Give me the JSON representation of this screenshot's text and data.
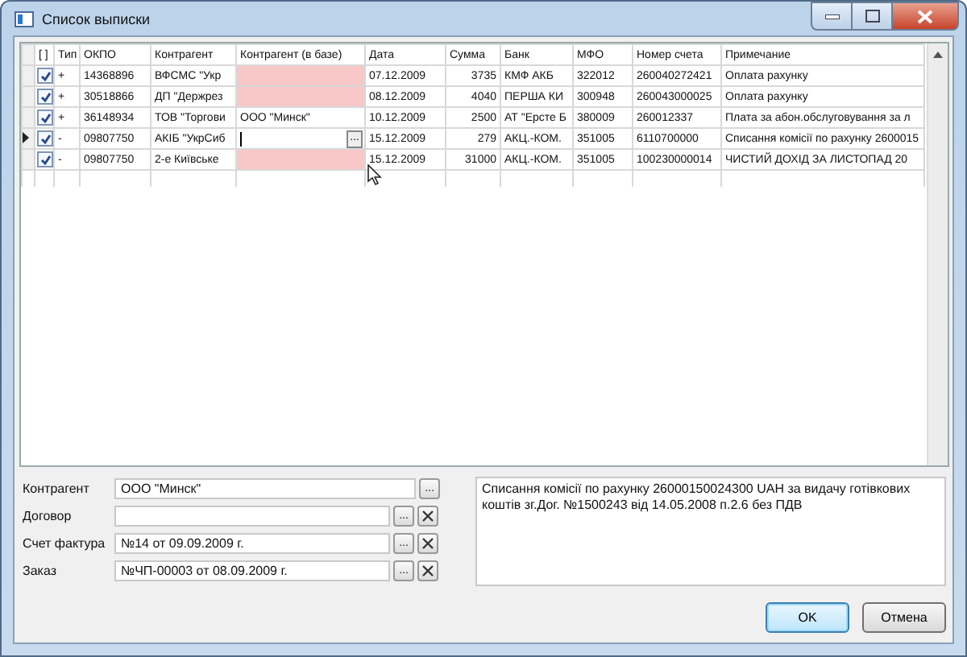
{
  "window": {
    "title": "Список выписки"
  },
  "columns": [
    "[ ]",
    "Тип",
    "ОКПО",
    "Контрагент",
    "Контрагент (в базе)",
    "Дата",
    "Сумма",
    "Банк",
    "МФО",
    "Номер счета",
    "Примечание"
  ],
  "rows": [
    {
      "current": false,
      "checked": true,
      "type": "+",
      "okpo": "14368896",
      "counterparty": "ВФСМС \"Укр",
      "base": "",
      "unmatched": true,
      "editing": false,
      "date": "07.12.2009",
      "sum": "3735",
      "bank": "КМФ АКБ",
      "mfo": "322012",
      "account": "260040272421",
      "note": "Оплата рахунку"
    },
    {
      "current": false,
      "checked": true,
      "type": "+",
      "okpo": "30518866",
      "counterparty": "ДП \"Держрез",
      "base": "",
      "unmatched": true,
      "editing": false,
      "date": "08.12.2009",
      "sum": "4040",
      "bank": "ПЕРША КИ",
      "mfo": "300948",
      "account": "260043000025",
      "note": "Оплата рахунку"
    },
    {
      "current": false,
      "checked": true,
      "type": "+",
      "okpo": "36148934",
      "counterparty": "ТОВ \"Торгови",
      "base": "ООО \"Минск\"",
      "unmatched": false,
      "editing": false,
      "date": "10.12.2009",
      "sum": "2500",
      "bank": "АТ \"Ерсте Б",
      "mfo": "380009",
      "account": "260012337",
      "note": "Плата за абон.обслуговування за л"
    },
    {
      "current": true,
      "checked": true,
      "type": "-",
      "okpo": "09807750",
      "counterparty": "АКІБ \"УкрСиб",
      "base": "",
      "unmatched": false,
      "editing": true,
      "date": "15.12.2009",
      "sum": "279",
      "bank": "АКЦ.-КОМ.",
      "mfo": "351005",
      "account": "6110700000",
      "note": "Списання комісії по рахунку 2600015"
    },
    {
      "current": false,
      "checked": true,
      "type": "-",
      "okpo": "09807750",
      "counterparty": "2-е Київське",
      "base": "",
      "unmatched": true,
      "editing": false,
      "date": "15.12.2009",
      "sum": "31000",
      "bank": "АКЦ.-КОМ.",
      "mfo": "351005",
      "account": "100230000014",
      "note": "ЧИСТИЙ ДОХІД ЗА ЛИСТОПАД 20"
    }
  ],
  "edit_button": "...",
  "fields": [
    {
      "label": "Контрагент",
      "value": "ООО \"Минск\"",
      "browse": "...",
      "clearable": false
    },
    {
      "label": "Договор",
      "browse": "...",
      "clearable": true
    },
    {
      "label": "Счет фактура",
      "value": "№14 от 09.09.2009 г.",
      "browse": "...",
      "clearable": true
    },
    {
      "label": "Заказ",
      "value": "№ЧП-00003 от 08.09.2009 г.",
      "browse": "...",
      "clearable": true
    }
  ],
  "memo": "Списання комісії по рахунку 26000150024300 UAH за видачу готівкових коштів зг.Дог. №1500243 від 14.05.2008 п.2.6 без ПДВ",
  "buttons": [
    {
      "label": "OK",
      "default": true
    },
    {
      "label": "Отмена",
      "default": false
    }
  ]
}
